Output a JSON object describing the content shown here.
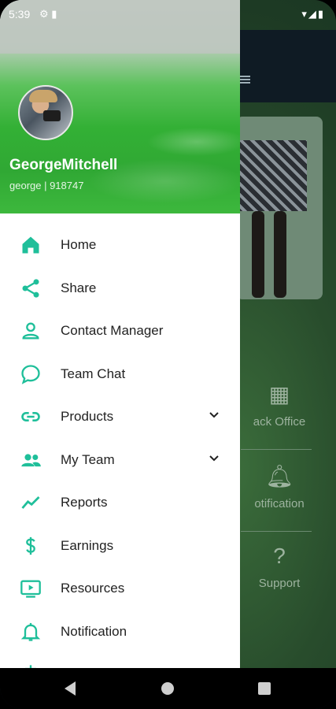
{
  "status": {
    "time": "5:39",
    "left_icons": "⚙ ▮",
    "right_icons": "▾◢▮"
  },
  "user": {
    "name": "GeorgeMitchell",
    "subtitle": "george  |  918747"
  },
  "menu": [
    {
      "label": "Home",
      "icon": "home-icon",
      "chevron": false
    },
    {
      "label": "Share",
      "icon": "share-icon",
      "chevron": false
    },
    {
      "label": "Contact Manager",
      "icon": "person-icon",
      "chevron": false
    },
    {
      "label": "Team Chat",
      "icon": "chat-bubble-icon",
      "chevron": false
    },
    {
      "label": "Products",
      "icon": "link-icon",
      "chevron": true
    },
    {
      "label": "My Team",
      "icon": "people-icon",
      "chevron": true
    },
    {
      "label": "Reports",
      "icon": "trending-up-icon",
      "chevron": false
    },
    {
      "label": "Earnings",
      "icon": "dollar-icon",
      "chevron": false
    },
    {
      "label": "Resources",
      "icon": "tv-play-icon",
      "chevron": false
    },
    {
      "label": "Notification",
      "icon": "bell-icon",
      "chevron": false
    }
  ],
  "background": {
    "tiles": [
      {
        "label": "ack Office",
        "icon": "building-icon"
      },
      {
        "label": "otification",
        "icon": "bell-icon"
      },
      {
        "label": "Support",
        "icon": "help-icon"
      }
    ]
  },
  "colors": {
    "accent": "#1fbf9a",
    "header_green": "#33b035"
  }
}
